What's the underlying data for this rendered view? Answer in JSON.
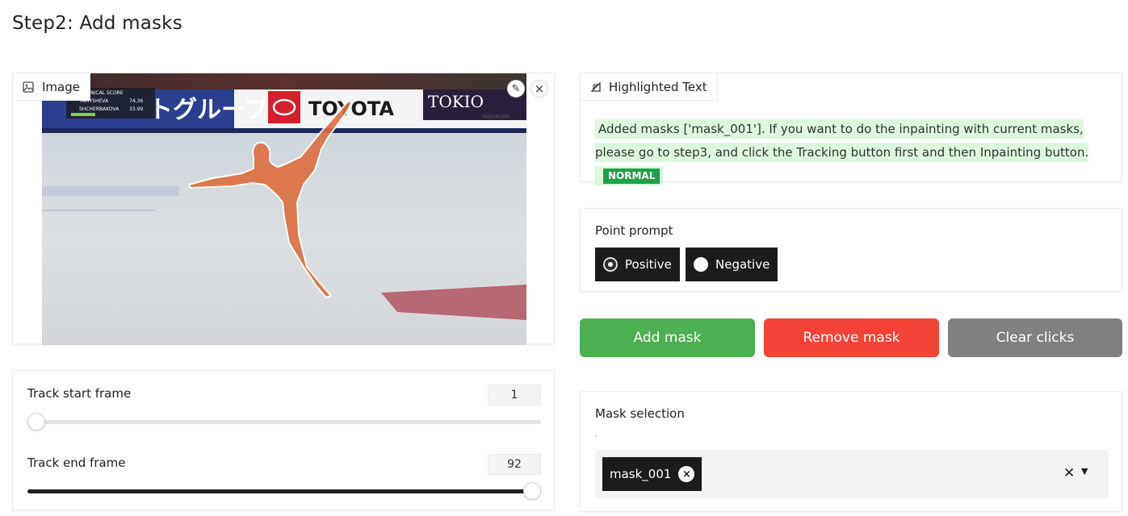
{
  "page": {
    "title": "Step2: Add masks"
  },
  "image_panel": {
    "label": "Image",
    "icons": {
      "label_icon": "image-icon",
      "edit": "pencil-icon",
      "close": "close-icon"
    },
    "overlay": {
      "scoreboard_title": "TECHNICAL SCORE",
      "name1": "TAMYSHEVA",
      "score1": "74.36",
      "name2": "SHCHERBAKOVA",
      "score2": "33.99",
      "banner1": "トグループ",
      "banner2": "TOYOTA",
      "banner3": "TOKIO",
      "banner4": "INKARAMI"
    }
  },
  "sliders": {
    "start": {
      "label": "Track start frame",
      "value": "1",
      "fraction": 0.0
    },
    "end": {
      "label": "Track end frame",
      "value": "92",
      "fraction": 1.0
    }
  },
  "highlighted_text": {
    "label": "Highlighted Text",
    "icon": "highlight-icon",
    "text": "Added masks ['mask_001']. If you want to do the inpainting with current masks, please go to step3, and click the Tracking button first and then Inpainting button.",
    "badge": "NORMAL",
    "badge_color": "#1fa14b"
  },
  "point_prompt": {
    "label": "Point prompt",
    "options": [
      {
        "label": "Positive",
        "checked": true
      },
      {
        "label": "Negative",
        "checked": false
      }
    ]
  },
  "actions": {
    "add_mask": {
      "label": "Add mask",
      "color": "#4cb050"
    },
    "remove_mask": {
      "label": "Remove mask",
      "color": "#f44336"
    },
    "clear_clicks": {
      "label": "Clear clicks",
      "color": "#808080"
    }
  },
  "mask_selection": {
    "label": "Mask selection",
    "info": ".",
    "selected": [
      "mask_001"
    ],
    "clear_icon": "close-icon",
    "dropdown_icon": "caret-down-icon"
  }
}
